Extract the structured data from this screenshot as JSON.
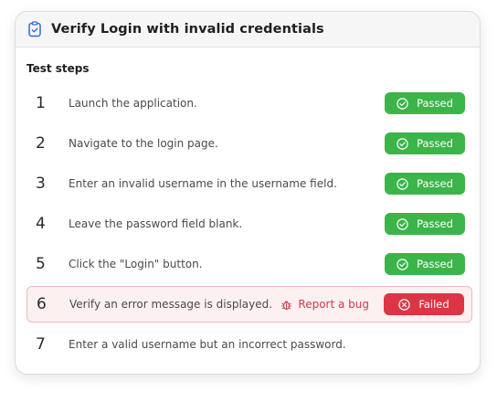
{
  "card": {
    "title": "Verify Login with invalid credentials",
    "section_label": "Test steps"
  },
  "colors": {
    "passed": "#3bb54a",
    "failed": "#dc3545",
    "report_bug": "#d4384f",
    "failed_row_bg": "#fdf0f1"
  },
  "steps": [
    {
      "num": "1",
      "text": "Launch the application.",
      "status": "Passed"
    },
    {
      "num": "2",
      "text": "Navigate to the login page.",
      "status": "Passed"
    },
    {
      "num": "3",
      "text": "Enter an invalid username in the username field.",
      "status": "Passed"
    },
    {
      "num": "4",
      "text": "Leave the password field blank.",
      "status": "Passed"
    },
    {
      "num": "5",
      "text": "Click the \"Login\" button.",
      "status": "Passed"
    },
    {
      "num": "6",
      "text": "Verify an error message is displayed.",
      "status": "Failed",
      "action": "Report a bug"
    },
    {
      "num": "7",
      "text": "Enter a valid username but an incorrect password.",
      "status": ""
    }
  ],
  "icons": {
    "header": "clipboard-test-icon",
    "passed": "check-circle-icon",
    "failed": "x-circle-icon",
    "report": "bug-icon"
  }
}
